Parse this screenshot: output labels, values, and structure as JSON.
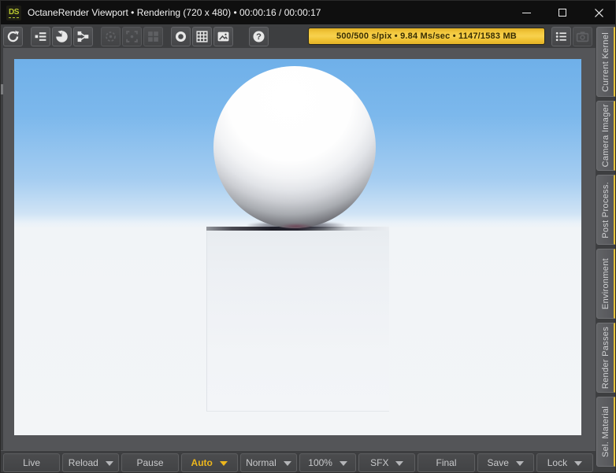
{
  "titlebar": {
    "icon_text": "DS",
    "title": "OctaneRender Viewport • Rendering (720 x 480) • 00:00:16 / 00:00:17"
  },
  "toolbar": {
    "progress_text": "500/500 s/pix • 9.84 Ms/sec • 1147/1583 MB",
    "icons": [
      {
        "name": "refresh",
        "enabled": true
      },
      {
        "name": "scene-tree",
        "enabled": true
      },
      {
        "name": "restart-render",
        "enabled": true
      },
      {
        "name": "network-render",
        "enabled": true
      },
      {
        "name": "pick-target",
        "enabled": false
      },
      {
        "name": "pick-focus",
        "enabled": false
      },
      {
        "name": "render-region",
        "enabled": false
      },
      {
        "name": "ring",
        "enabled": true
      },
      {
        "name": "grid-overlay",
        "enabled": true
      },
      {
        "name": "background-image",
        "enabled": true
      },
      {
        "name": "help",
        "enabled": true
      },
      {
        "name": "render-log",
        "enabled": true
      },
      {
        "name": "snapshot-camera",
        "enabled": false
      }
    ]
  },
  "right_tabs": [
    "Current Kernel",
    "Camera Imager",
    "Post Process.",
    "Environment",
    "Render Passes",
    "Sel. Material"
  ],
  "bottom_toolbar": {
    "buttons": [
      {
        "label": "Live",
        "dropdown": false,
        "active": false
      },
      {
        "label": "Reload",
        "dropdown": true,
        "active": false
      },
      {
        "label": "Pause",
        "dropdown": false,
        "active": false
      },
      {
        "label": "Auto",
        "dropdown": true,
        "active": true
      },
      {
        "label": "Normal",
        "dropdown": true,
        "active": false
      },
      {
        "label": "100%",
        "dropdown": true,
        "active": false
      },
      {
        "label": "SFX",
        "dropdown": true,
        "active": false
      },
      {
        "label": "Final",
        "dropdown": false,
        "active": false
      },
      {
        "label": "Save",
        "dropdown": true,
        "active": false
      },
      {
        "label": "Lock",
        "dropdown": true,
        "active": false
      }
    ]
  },
  "colors": {
    "accent_yellow": "#f2c335",
    "auto_active_text": "#ecb61d",
    "sky_top": "#6fb0e9",
    "viewport_background": "#545558",
    "titlebar_background": "#0f0f0f"
  }
}
